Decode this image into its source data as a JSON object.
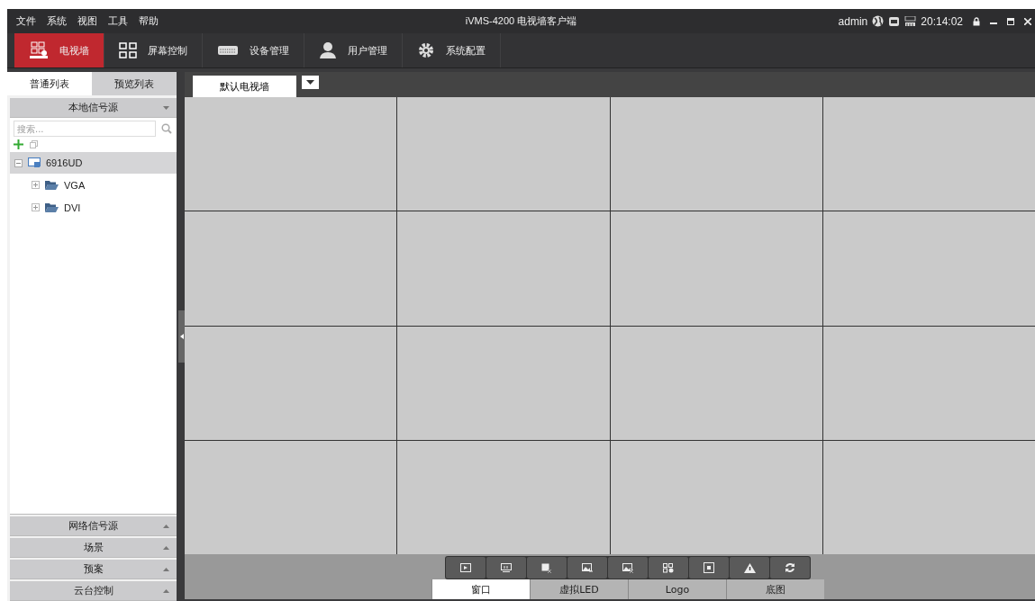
{
  "menu": [
    "文件",
    "系统",
    "视图",
    "工具",
    "帮助"
  ],
  "window": {
    "title": "iVMS-4200 电视墙客户端",
    "user": "admin",
    "time": "20:14:02"
  },
  "nav": [
    {
      "label": "电视墙",
      "kind": "wall",
      "selected": true
    },
    {
      "label": "屏幕控制",
      "kind": "grid",
      "selected": false
    },
    {
      "label": "设备管理",
      "kind": "device",
      "selected": false
    },
    {
      "label": "用户管理",
      "kind": "user",
      "selected": false
    },
    {
      "label": "系统配置",
      "kind": "gear",
      "selected": false
    }
  ],
  "sidebar": {
    "tabs": [
      {
        "label": "普通列表",
        "selected": true
      },
      {
        "label": "预览列表",
        "selected": false
      }
    ],
    "section": {
      "title": "本地信号源",
      "expanded": true
    },
    "search": {
      "placeholder": "搜索..."
    },
    "tree": [
      {
        "label": "6916UD",
        "expanded": true,
        "selected": true,
        "children": [
          {
            "label": "VGA",
            "expanded": false
          },
          {
            "label": "DVI",
            "expanded": false
          }
        ]
      }
    ],
    "panels": [
      {
        "title": "网络信号源",
        "expanded": false
      },
      {
        "title": "场景",
        "expanded": false
      },
      {
        "title": "预案",
        "expanded": false
      },
      {
        "title": "云台控制",
        "expanded": false
      }
    ]
  },
  "wall_tabs": [
    {
      "label": "默认电视墙"
    }
  ],
  "bottom_tabs": [
    {
      "label": "窗口",
      "selected": true
    },
    {
      "label": "虚拟LED",
      "selected": false
    },
    {
      "label": "Logo",
      "selected": false
    },
    {
      "label": "底图",
      "selected": false
    }
  ]
}
